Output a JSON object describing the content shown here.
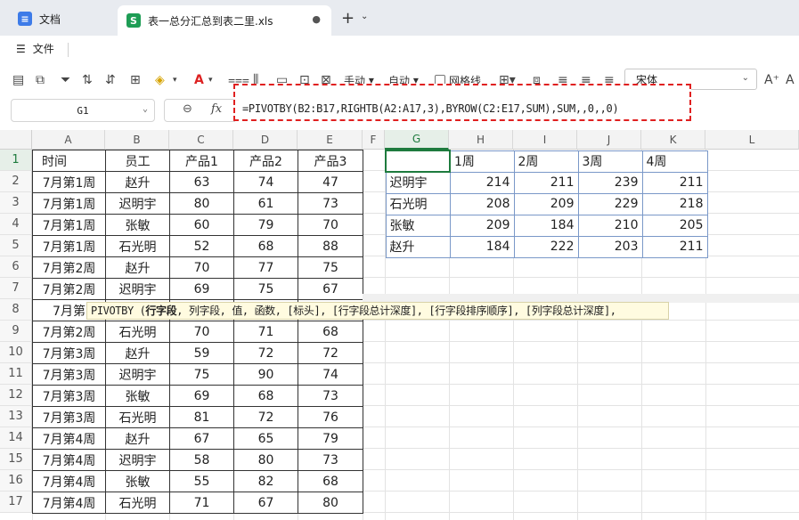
{
  "tabs": {
    "docs_label": "文档",
    "file_label": "表一总分汇总到表二里.xls",
    "docs_icon": "docs-icon",
    "sheet_icon": "sheet-s-icon",
    "sheet_icon_letter": "S"
  },
  "menu": {
    "file_label": "文件"
  },
  "toolbar": {
    "wrap_label": "手动",
    "auto_label": "自动",
    "gridlines_label": "网格线",
    "font_name": "宋体"
  },
  "formula_bar": {
    "cell_ref": "G1",
    "fx_label": "fx",
    "formula": "=PIVOTBY(B2:B17,RIGHTB(A2:A17,3),BYROW(C2:E17,SUM),SUM,,0,,0)"
  },
  "columns": [
    "A",
    "B",
    "C",
    "D",
    "E",
    "F",
    "G",
    "H",
    "I",
    "J",
    "K",
    "L"
  ],
  "rows": [
    "1",
    "2",
    "3",
    "4",
    "5",
    "6",
    "7",
    "8",
    "9",
    "10",
    "11",
    "12",
    "13",
    "14",
    "15",
    "16",
    "17"
  ],
  "table": {
    "headers": [
      "时间",
      "员工",
      "产品1",
      "产品2",
      "产品3"
    ],
    "rows": [
      [
        "7月第1周",
        "赵升",
        "63",
        "74",
        "47"
      ],
      [
        "7月第1周",
        "迟明宇",
        "80",
        "61",
        "73"
      ],
      [
        "7月第1周",
        "张敏",
        "60",
        "79",
        "70"
      ],
      [
        "7月第1周",
        "石光明",
        "52",
        "68",
        "88"
      ],
      [
        "7月第2周",
        "赵升",
        "70",
        "77",
        "75"
      ],
      [
        "7月第2周",
        "迟明宇",
        "69",
        "75",
        "67"
      ],
      [
        "7月第",
        "",
        " ",
        "",
        ""
      ],
      [
        "7月第2周",
        "石光明",
        "70",
        "71",
        "68"
      ],
      [
        "7月第3周",
        "赵升",
        "59",
        "72",
        "72"
      ],
      [
        "7月第3周",
        "迟明宇",
        "75",
        "90",
        "74"
      ],
      [
        "7月第3周",
        "张敏",
        "69",
        "68",
        "73"
      ],
      [
        "7月第3周",
        "石光明",
        "81",
        "72",
        "76"
      ],
      [
        "7月第4周",
        "赵升",
        "67",
        "65",
        "79"
      ],
      [
        "7月第4周",
        "迟明宇",
        "58",
        "80",
        "73"
      ],
      [
        "7月第4周",
        "张敏",
        "55",
        "82",
        "68"
      ],
      [
        "7月第4周",
        "石光明",
        "71",
        "67",
        "80"
      ]
    ]
  },
  "pivot": {
    "headers": [
      "",
      "1周",
      "2周",
      "3周",
      "4周"
    ],
    "rows": [
      [
        "迟明宇",
        "214",
        "211",
        "239",
        "211"
      ],
      [
        "石光明",
        "208",
        "209",
        "229",
        "218"
      ],
      [
        "张敏",
        "209",
        "184",
        "210",
        "205"
      ],
      [
        "赵升",
        "184",
        "222",
        "203",
        "211"
      ]
    ]
  },
  "tooltip": {
    "fn": "PIVOTBY (",
    "bold_arg": "行字段",
    "rest": ", 列字段, 值, 函数, [标头], [行字段总计深度], [行字段排序顺序], [列字段总计深度],"
  },
  "colors": {
    "accent": "#1e7b3e",
    "formula_border": "#e02020",
    "pivot_border": "#3a5ea8"
  }
}
